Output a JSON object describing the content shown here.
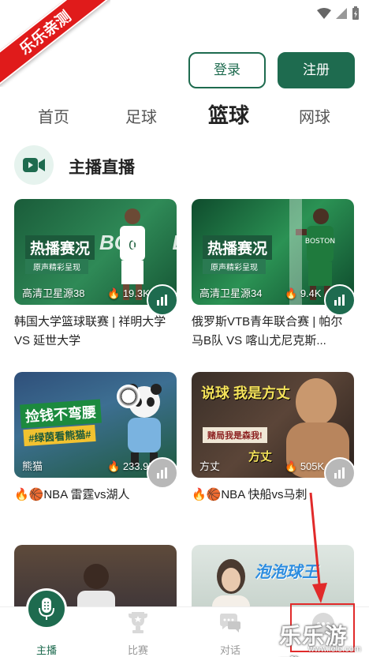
{
  "ribbon": {
    "text": "乐乐亲测"
  },
  "header": {
    "login_label": "登录",
    "register_label": "注册"
  },
  "tabs": [
    {
      "label": "首页"
    },
    {
      "label": "足球"
    },
    {
      "label": "篮球"
    },
    {
      "label": "网球"
    }
  ],
  "section": {
    "title": "主播直播"
  },
  "cards": [
    {
      "hot_badge": "热播赛况",
      "hot_sub": "原声精彩呈现",
      "source": "高清卫星源38",
      "count": "19.3K",
      "title": "韩国大学篮球联赛 | 祥明大学 VS 延世大学"
    },
    {
      "hot_badge": "热播赛况",
      "hot_sub": "原声精彩呈现",
      "source": "高清卫星源34",
      "count": "9.4K",
      "title": "俄罗斯VTB青年联合赛 | 帕尔马B队 VS 喀山尤尼克斯..."
    },
    {
      "banner": "捡钱不弯腰",
      "banner_sub": "#绿茵看熊猫#",
      "source": "熊猫",
      "count": "233.9K",
      "title": "🔥🏀NBA 雷霆vs湖人"
    },
    {
      "banner": "说球 我是方丈",
      "banner_sub": "赌局我是森我!",
      "banner_sub2": "方丈",
      "source": "方丈",
      "count": "505K",
      "title": "🔥🏀NBA  快船vs马刺"
    },
    {
      "banner": "",
      "source": "",
      "count": "",
      "title": ""
    },
    {
      "banner": "泡泡球王",
      "source": "",
      "count": "",
      "title": ""
    }
  ],
  "bottom_nav": [
    {
      "label": "主播",
      "icon": "mic-icon"
    },
    {
      "label": "比赛",
      "icon": "trophy-icon"
    },
    {
      "label": "对话",
      "icon": "chat-icon"
    },
    {
      "label": "",
      "icon": "more-icon"
    }
  ],
  "watermark": {
    "text": "乐乐游戏",
    "sub": "www.lele.com"
  },
  "colors": {
    "accent": "#1e6b4f",
    "ribbon": "#e01b1b"
  }
}
